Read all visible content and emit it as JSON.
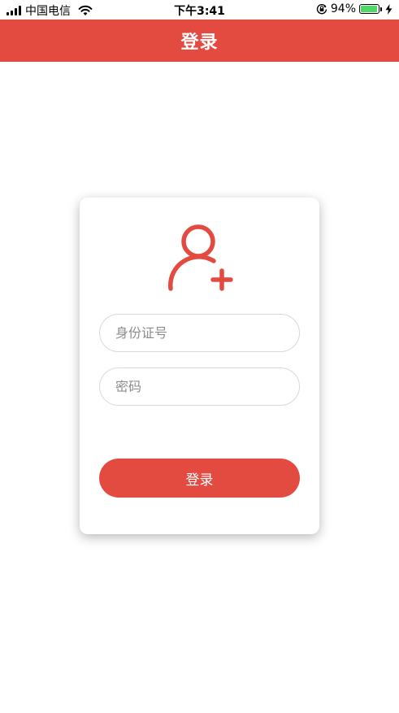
{
  "status_bar": {
    "carrier": "中国电信",
    "time": "下午3:41",
    "battery_percent": "94%",
    "battery_level": 0.94,
    "battery_color": "#4cd964"
  },
  "nav": {
    "title": "登录",
    "background": "#e34a40"
  },
  "login_card": {
    "icon": "add-user-icon",
    "accent_color": "#e34a40",
    "id_field": {
      "placeholder": "身份证号",
      "value": ""
    },
    "password_field": {
      "placeholder": "密码",
      "value": ""
    },
    "login_button_label": "登录"
  }
}
